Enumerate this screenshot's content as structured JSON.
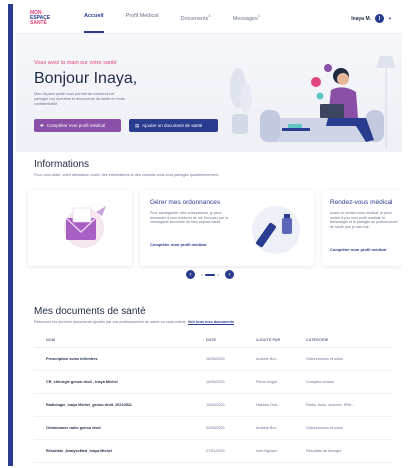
{
  "header": {
    "logo": [
      "MON",
      "ESPACE",
      "SANTÉ"
    ],
    "nav": [
      {
        "label": "Accueil",
        "badge": ""
      },
      {
        "label": "Profil Médical",
        "badge": ""
      },
      {
        "label": "Documents",
        "badge": "4"
      },
      {
        "label": "Messages",
        "badge": "1"
      }
    ],
    "user_name": "Inaya M.",
    "user_initial": "I"
  },
  "hero": {
    "tag": "Vous avez la main sur votre santé",
    "title": "Bonjour Inaya,",
    "description": "Mon espace santé vous permet de conserver et partager vos données et documents de santé en toute confidentialité.",
    "btn_profile": "Compléter mon profil médical",
    "btn_add": "Ajouter un document de santé"
  },
  "informations": {
    "title": "Informations",
    "description": "Pour vous aider, votre attestation covid, des informations et des conseils vous sont partagés quotidiennement.",
    "cards": [
      {
        "title": "Gérer mes ordonnances",
        "text": "Pour sauvegarder mes ordonnances, je peux demander à mon médecin de me l'envoyer par la messagerie sécurisée de Mon espace santé.",
        "link": "Compléter mon profil médical"
      },
      {
        "title": "Rendez-vous médical",
        "text": "Avant un rendez-vous médical, je peux mettre à jour mon profil médical, le télécharger et le partager au professionnel de santé que je vais voir.",
        "link": "Compléter mon profil médical"
      }
    ]
  },
  "documents": {
    "title": "Mes documents de santé",
    "description": "Retrouvez les derniers documents ajoutés par vos professionnels de santé ou vous-même.",
    "link": "Voir tous mes documents",
    "columns": [
      "NOM",
      "DATE",
      "AJOUTÉ PAR",
      "CATÉGORIE"
    ],
    "rows": [
      {
        "name": "Prescription soins infirmiers",
        "date": "16/06/2021",
        "by": "Antoine Bot...",
        "category": "Ordonnances et soins"
      },
      {
        "name": "CR_chirurgie genou droit - Inaya Michel",
        "date": "16/06/2021",
        "by": "Pierre Angot",
        "category": "Comptes rendus"
      },
      {
        "name": "Radiologie_Inaya Michel_genou droit_20210511",
        "date": "15/05/2021",
        "by": "Hakima Oud...",
        "category": "Radio, écho, scanner, IRM..."
      },
      {
        "name": "Ordonnance radio genou droit",
        "date": "02/05/2021",
        "by": "Antoine Bot...",
        "category": "Ordonnances et soins"
      },
      {
        "name": "Résultats_AnalyseMed_Inaya Michel",
        "date": "27/01/2021",
        "by": "Inès Nguyen",
        "category": "Résultats de biologie"
      }
    ]
  },
  "colors": {
    "primary": "#2a3c8f",
    "accent": "#e0457b",
    "purple": "#8a4fa6",
    "text": "#1f2a44",
    "muted": "#6b7390"
  }
}
